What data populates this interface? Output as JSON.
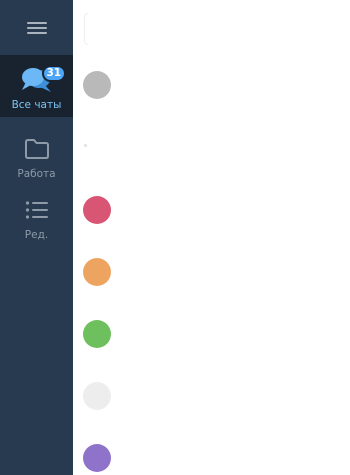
{
  "sidebar": {
    "menu_icon": "hamburger-icon",
    "folders": [
      {
        "label": "Все чаты",
        "icon": "chats-icon",
        "badge": "31",
        "active": true
      },
      {
        "label": "Работа",
        "icon": "folder-icon",
        "active": false
      },
      {
        "label": "Ред.",
        "icon": "list-edit-icon",
        "active": false
      }
    ]
  },
  "colors": {
    "sidebar_bg": "#283a4f",
    "active_bg": "#19232f",
    "accent": "#4ea4f6",
    "active_label": "#7dc4f5",
    "inactive_label": "#8e9aa8"
  },
  "chat_avatars": [
    {
      "color": "#b9b9b9"
    },
    {
      "color": "#d95574"
    },
    {
      "color": "#eea461"
    },
    {
      "color": "#6ebf5e"
    },
    {
      "color": "#ededed"
    },
    {
      "color": "#8f72c9"
    }
  ]
}
